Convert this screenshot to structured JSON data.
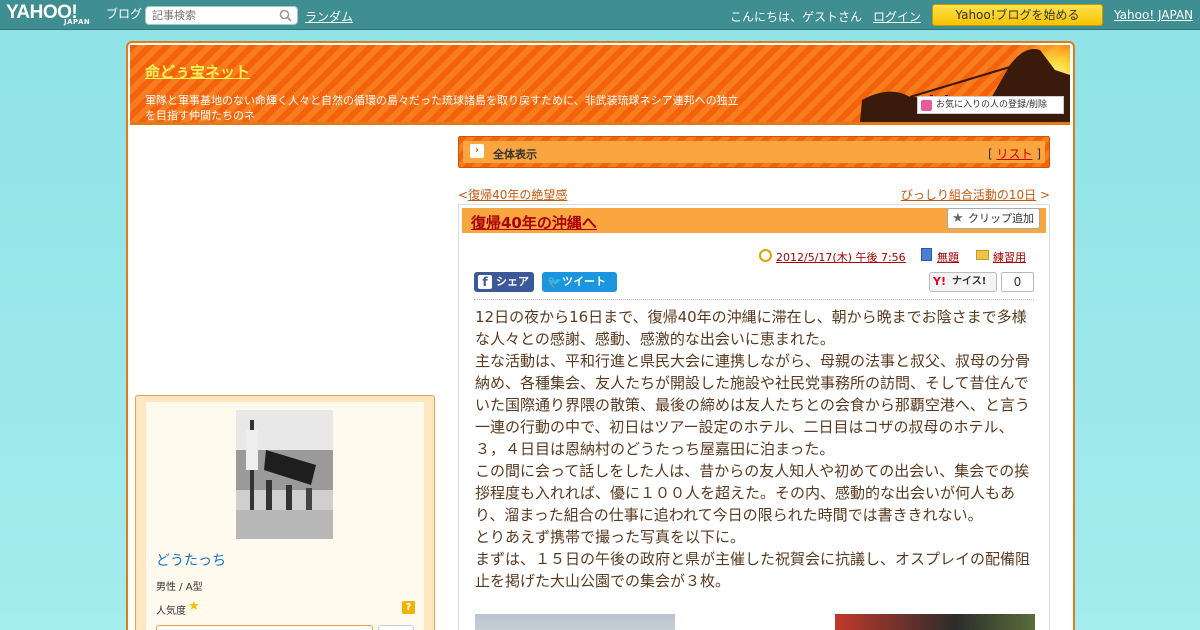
{
  "topbar": {
    "logo_yahoo": "YAHOO!",
    "logo_japan": "JAPAN",
    "logo_blog": "ブログ",
    "search_placeholder": "記事検索",
    "random": "ランダム",
    "greeting": "こんにちは、ゲストさん",
    "login": "ログイン",
    "start_blog": "Yahoo!ブログを始める",
    "yahoo_japan": "Yahoo! JAPAN"
  },
  "header": {
    "title": "命どぅ宝ネット",
    "description": "軍隊と軍事基地のない命輝く人々と自然の循環の島々だった琉球諸島を取り戻すために、非武装琉球ネシア連邦への独立を目指す仲間たちのネ",
    "favorite": "お気に入りの人の登録/削除"
  },
  "profile": {
    "name": "どうたっち",
    "gender": "男性 / A型",
    "popularity": "人気度",
    "help": "?"
  },
  "bar": {
    "label": "全体表示",
    "list_open": "[",
    "list": "リスト",
    "list_close": "]"
  },
  "nav": {
    "prev_mark": "<",
    "prev": "復帰40年の絶望感",
    "next": "びっしり組合活動の10日",
    "next_mark": ">"
  },
  "article": {
    "title": "復帰40年の沖縄へ",
    "clip": "クリップ追加",
    "date": "2012/5/17(木) 午後 7:56",
    "theme": "無題",
    "category": "練習用",
    "share_fb": "シェア",
    "share_tw": "ツイート",
    "nice": "ナイス!",
    "nice_count": "0",
    "paragraphs": [
      "12日の夜から16日まで、復帰40年の沖縄に滞在し、朝から晩までお陰さまで多様な人々との感謝、感動、感激的な出会いに恵まれた。",
      "主な活動は、平和行進と県民大会に連携しながら、母親の法事と叔父、叔母の分骨納め、各種集会、友人たちが開設した施設や社民党事務所の訪問、そして昔住んでいた国際通り界隈の散策、最後の締めは友人たちとの会食から那覇空港へ、と言う一連の行動の中で、初日はツアー設定のホテル、二日目はコザの叔母のホテル、３，４日目は恩納村のどうたっち屋嘉田に泊まった。",
      "この間に会って話しをした人は、昔からの友人知人や初めての出会い、集会での挨拶程度も入れれば、優に１００人を超えた。その内、感動的な出会いが何人もあり、溜まった組合の仕事に追われて今日の限られた時間では書ききれない。",
      "とりあえず携帯で撮った写真を以下に。",
      "まずは、１５日の午後の政府と県が主催した祝賀会に抗議し、オスプレイの配備阻止を掲げた大山公園での集会が３枚。"
    ]
  },
  "icons": {
    "search": "search-icon",
    "heart": "heart-icon",
    "arrow": "arrow-right-icon",
    "star": "star-icon",
    "clock": "clock-icon",
    "book": "book-icon",
    "folder": "folder-icon",
    "facebook": "facebook-icon",
    "twitter": "twitter-icon",
    "yahoo": "yahoo-icon"
  },
  "colors": {
    "topbar": "#3f8e91",
    "accent_orange": "#f4620c",
    "title_yellow": "#fff35a",
    "link_red": "#aa0000"
  }
}
